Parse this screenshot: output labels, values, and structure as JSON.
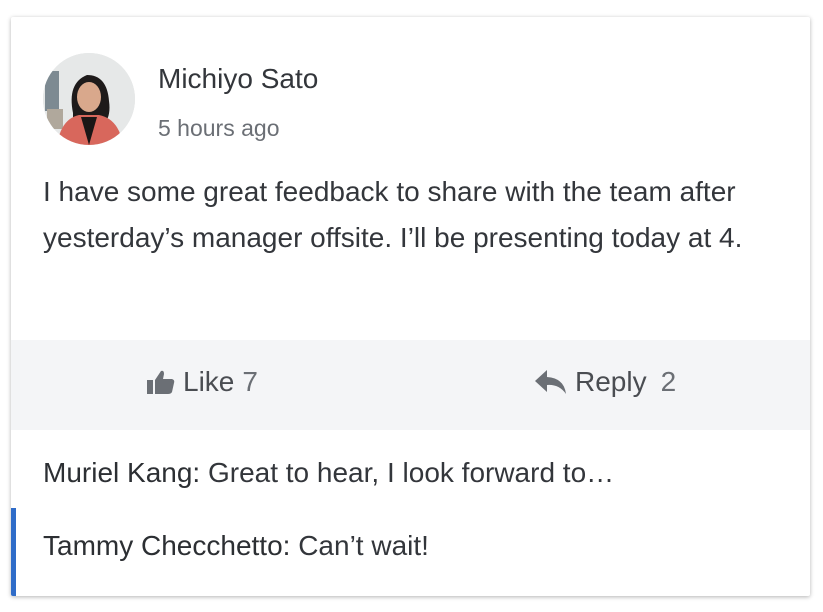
{
  "post": {
    "author": "Michiyo Sato",
    "time": "5 hours ago",
    "body": "I have some great feedback to share with the team after yesterday’s manager offsite. I’ll be presenting today at 4."
  },
  "actions": {
    "like_label": "Like",
    "like_count": "7",
    "reply_label": "Reply",
    "reply_count": "2"
  },
  "comments": [
    {
      "author": "Muriel Kang:",
      "text": "Great to hear, I look forward to…"
    },
    {
      "author": "Tammy Checchetto:",
      "text": "Can’t wait!"
    }
  ],
  "colors": {
    "accent": "#2f6cc8",
    "action_bar": "#f4f5f7"
  }
}
